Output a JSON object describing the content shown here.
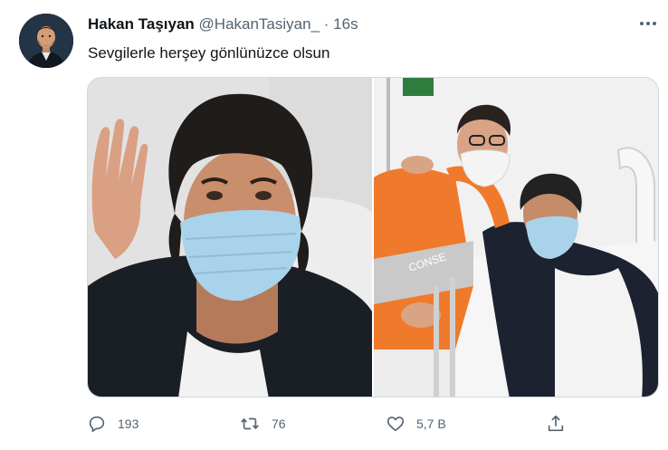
{
  "author": {
    "display_name": "Hakan Taşıyan",
    "handle": "@HakanTasiyan_",
    "separator": "·",
    "timestamp": "16s"
  },
  "tweet": {
    "text": "Sevgilerle herşey gönlünüzce olsun"
  },
  "media": {
    "photos": [
      {
        "description_icon": "photo-man-waving-mask"
      },
      {
        "description_icon": "photo-two-men-hospital"
      }
    ],
    "badge_text": "CONSE"
  },
  "actions": {
    "reply_count": "193",
    "retweet_count": "76",
    "like_count": "5,7 B"
  },
  "colors": {
    "text_primary": "#0f1419",
    "text_secondary": "#536471",
    "border": "#cfd9de",
    "mask": "#a9d3ea"
  }
}
